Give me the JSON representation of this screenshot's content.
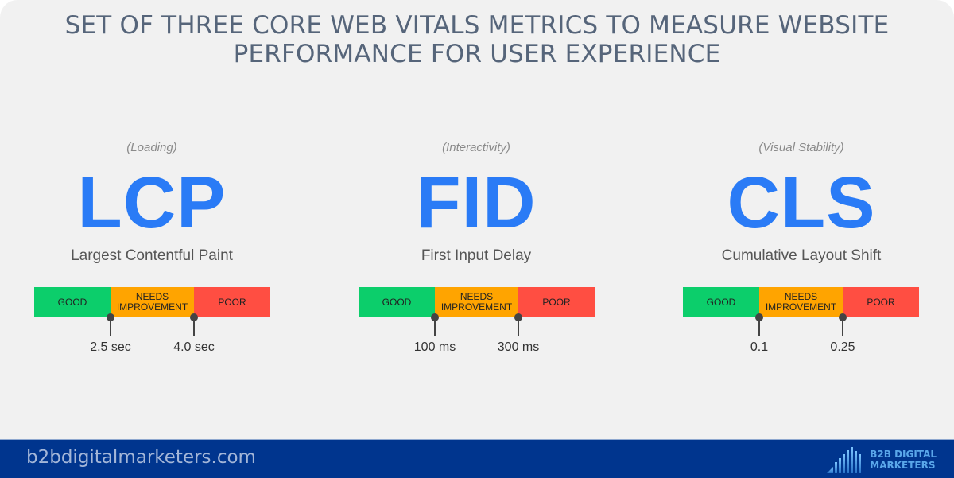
{
  "title": {
    "line1": "SET OF THREE CORE WEB VITALS METRICS TO MEASURE WEBSITE",
    "line2": "PERFORMANCE FOR USER EXPERIENCE"
  },
  "metrics": [
    {
      "category": "(Loading)",
      "abbr": "LCP",
      "name": "Largest Contentful Paint",
      "segments": [
        "GOOD",
        "NEEDS IMPROVEMENT",
        "POOR"
      ],
      "thresholds": [
        "2.5 sec",
        "4.0 sec"
      ]
    },
    {
      "category": "(Interactivity)",
      "abbr": "FID",
      "name": "First Input Delay",
      "segments": [
        "GOOD",
        "NEEDS IMPROVEMENT",
        "POOR"
      ],
      "thresholds": [
        "100 ms",
        "300 ms"
      ]
    },
    {
      "category": "(Visual Stability)",
      "abbr": "CLS",
      "name": "Cumulative Layout Shift",
      "segments": [
        "GOOD",
        "NEEDS IMPROVEMENT",
        "POOR"
      ],
      "thresholds": [
        "0.1",
        "0.25"
      ]
    }
  ],
  "colors": {
    "good": "#0cce6b",
    "needs_improvement": "#ffa400",
    "poor": "#ff4e42",
    "accent": "#2a7bf6",
    "footer": "#00358e"
  },
  "footer": {
    "domain": "b2bdigitalmarketers.com",
    "logo_line1": "B2B DIGITAL",
    "logo_line2": "MARKETERS",
    "logo_icon": "bar-chart-icon"
  }
}
